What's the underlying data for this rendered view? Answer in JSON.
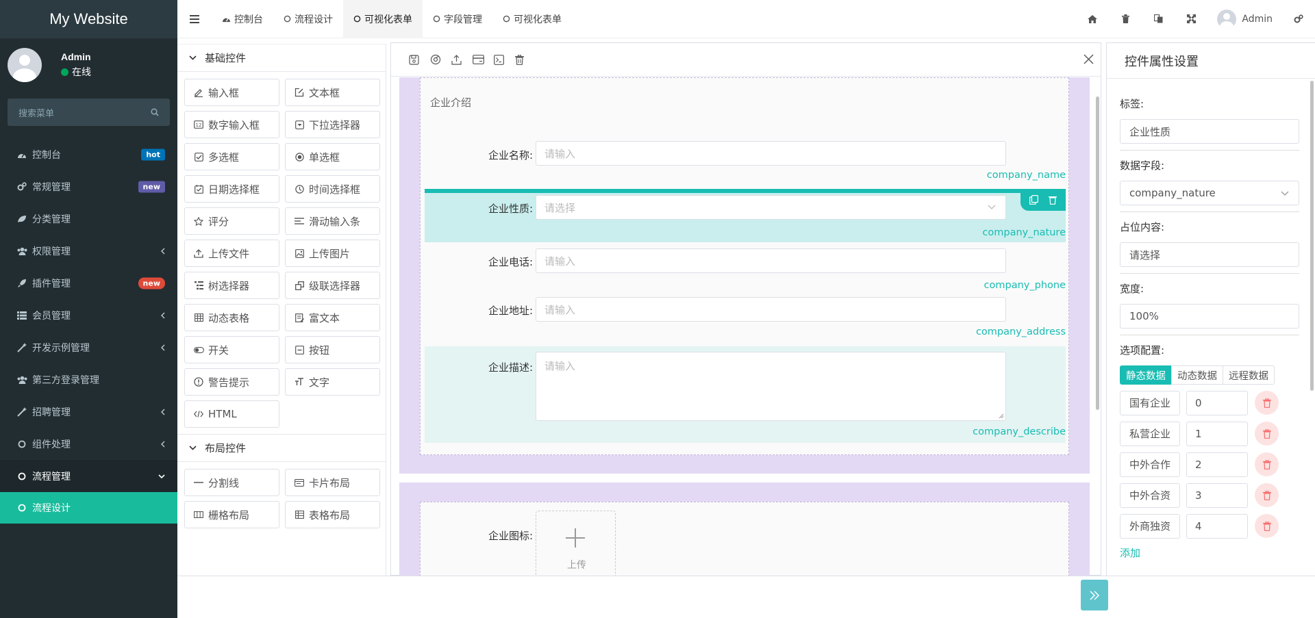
{
  "brand": "My Website",
  "user": {
    "name": "Admin",
    "status": "在线"
  },
  "sidebar": {
    "search_placeholder": "搜索菜单",
    "items": [
      {
        "label": "控制台",
        "badge": "hot"
      },
      {
        "label": "常规管理",
        "badge": "new"
      },
      {
        "label": "分类管理"
      },
      {
        "label": "权限管理"
      },
      {
        "label": "插件管理",
        "badge": "new"
      },
      {
        "label": "会员管理"
      },
      {
        "label": "开发示例管理"
      },
      {
        "label": "第三方登录管理"
      },
      {
        "label": "招聘管理"
      },
      {
        "label": "组件处理"
      },
      {
        "label": "流程管理"
      },
      {
        "label": "流程设计"
      }
    ]
  },
  "topbar": {
    "tabs": [
      "控制台",
      "流程设计",
      "可视化表单",
      "字段管理",
      "可视化表单"
    ],
    "user": "Admin"
  },
  "controls": {
    "basic_title": "基础控件",
    "basic": [
      "输入框",
      "文本框",
      "数字输入框",
      "下拉选择器",
      "多选框",
      "单选框",
      "日期选择框",
      "时间选择框",
      "评分",
      "滑动输入条",
      "上传文件",
      "上传图片",
      "树选择器",
      "级联选择器",
      "动态表格",
      "富文本",
      "开关",
      "按钮",
      "警告提示",
      "文字",
      "HTML"
    ],
    "layout_title": "布局控件",
    "layout": [
      "分割线",
      "卡片布局",
      "栅格布局",
      "表格布局"
    ]
  },
  "form": {
    "card_title": "企业介绍",
    "fields": [
      {
        "label": "企业名称:",
        "placeholder": "请输入",
        "name": "company_name"
      },
      {
        "label": "企业性质:",
        "placeholder": "请选择",
        "name": "company_nature"
      },
      {
        "label": "企业电话:",
        "placeholder": "请输入",
        "name": "company_phone"
      },
      {
        "label": "企业地址:",
        "placeholder": "请输入",
        "name": "company_address"
      },
      {
        "label": "企业描述:",
        "placeholder": "请输入",
        "name": "company_describe"
      }
    ],
    "logo_label": "企业图标:",
    "upload_text": "上传"
  },
  "props": {
    "title": "控件属性设置",
    "label_title": "标签:",
    "label_value": "企业性质",
    "field_title": "数据字段:",
    "field_value": "company_nature",
    "placeholder_title": "占位内容:",
    "placeholder_value": "请选择",
    "width_title": "宽度:",
    "width_value": "100%",
    "options_title": "选项配置:",
    "source_tabs": [
      "静态数据",
      "动态数据",
      "远程数据"
    ],
    "options": [
      {
        "label": "国有企业",
        "value": "0"
      },
      {
        "label": "私营企业",
        "value": "1"
      },
      {
        "label": "中外合作",
        "value": "2"
      },
      {
        "label": "中外合资",
        "value": "3"
      },
      {
        "label": "外商独资",
        "value": "4"
      }
    ],
    "add_label": "添加"
  },
  "colors": {
    "accent": "#18bc9c",
    "sidebar_bg": "#222d32",
    "section_bg": "#e3d9f5",
    "selected_bg": "#c9eeed"
  }
}
